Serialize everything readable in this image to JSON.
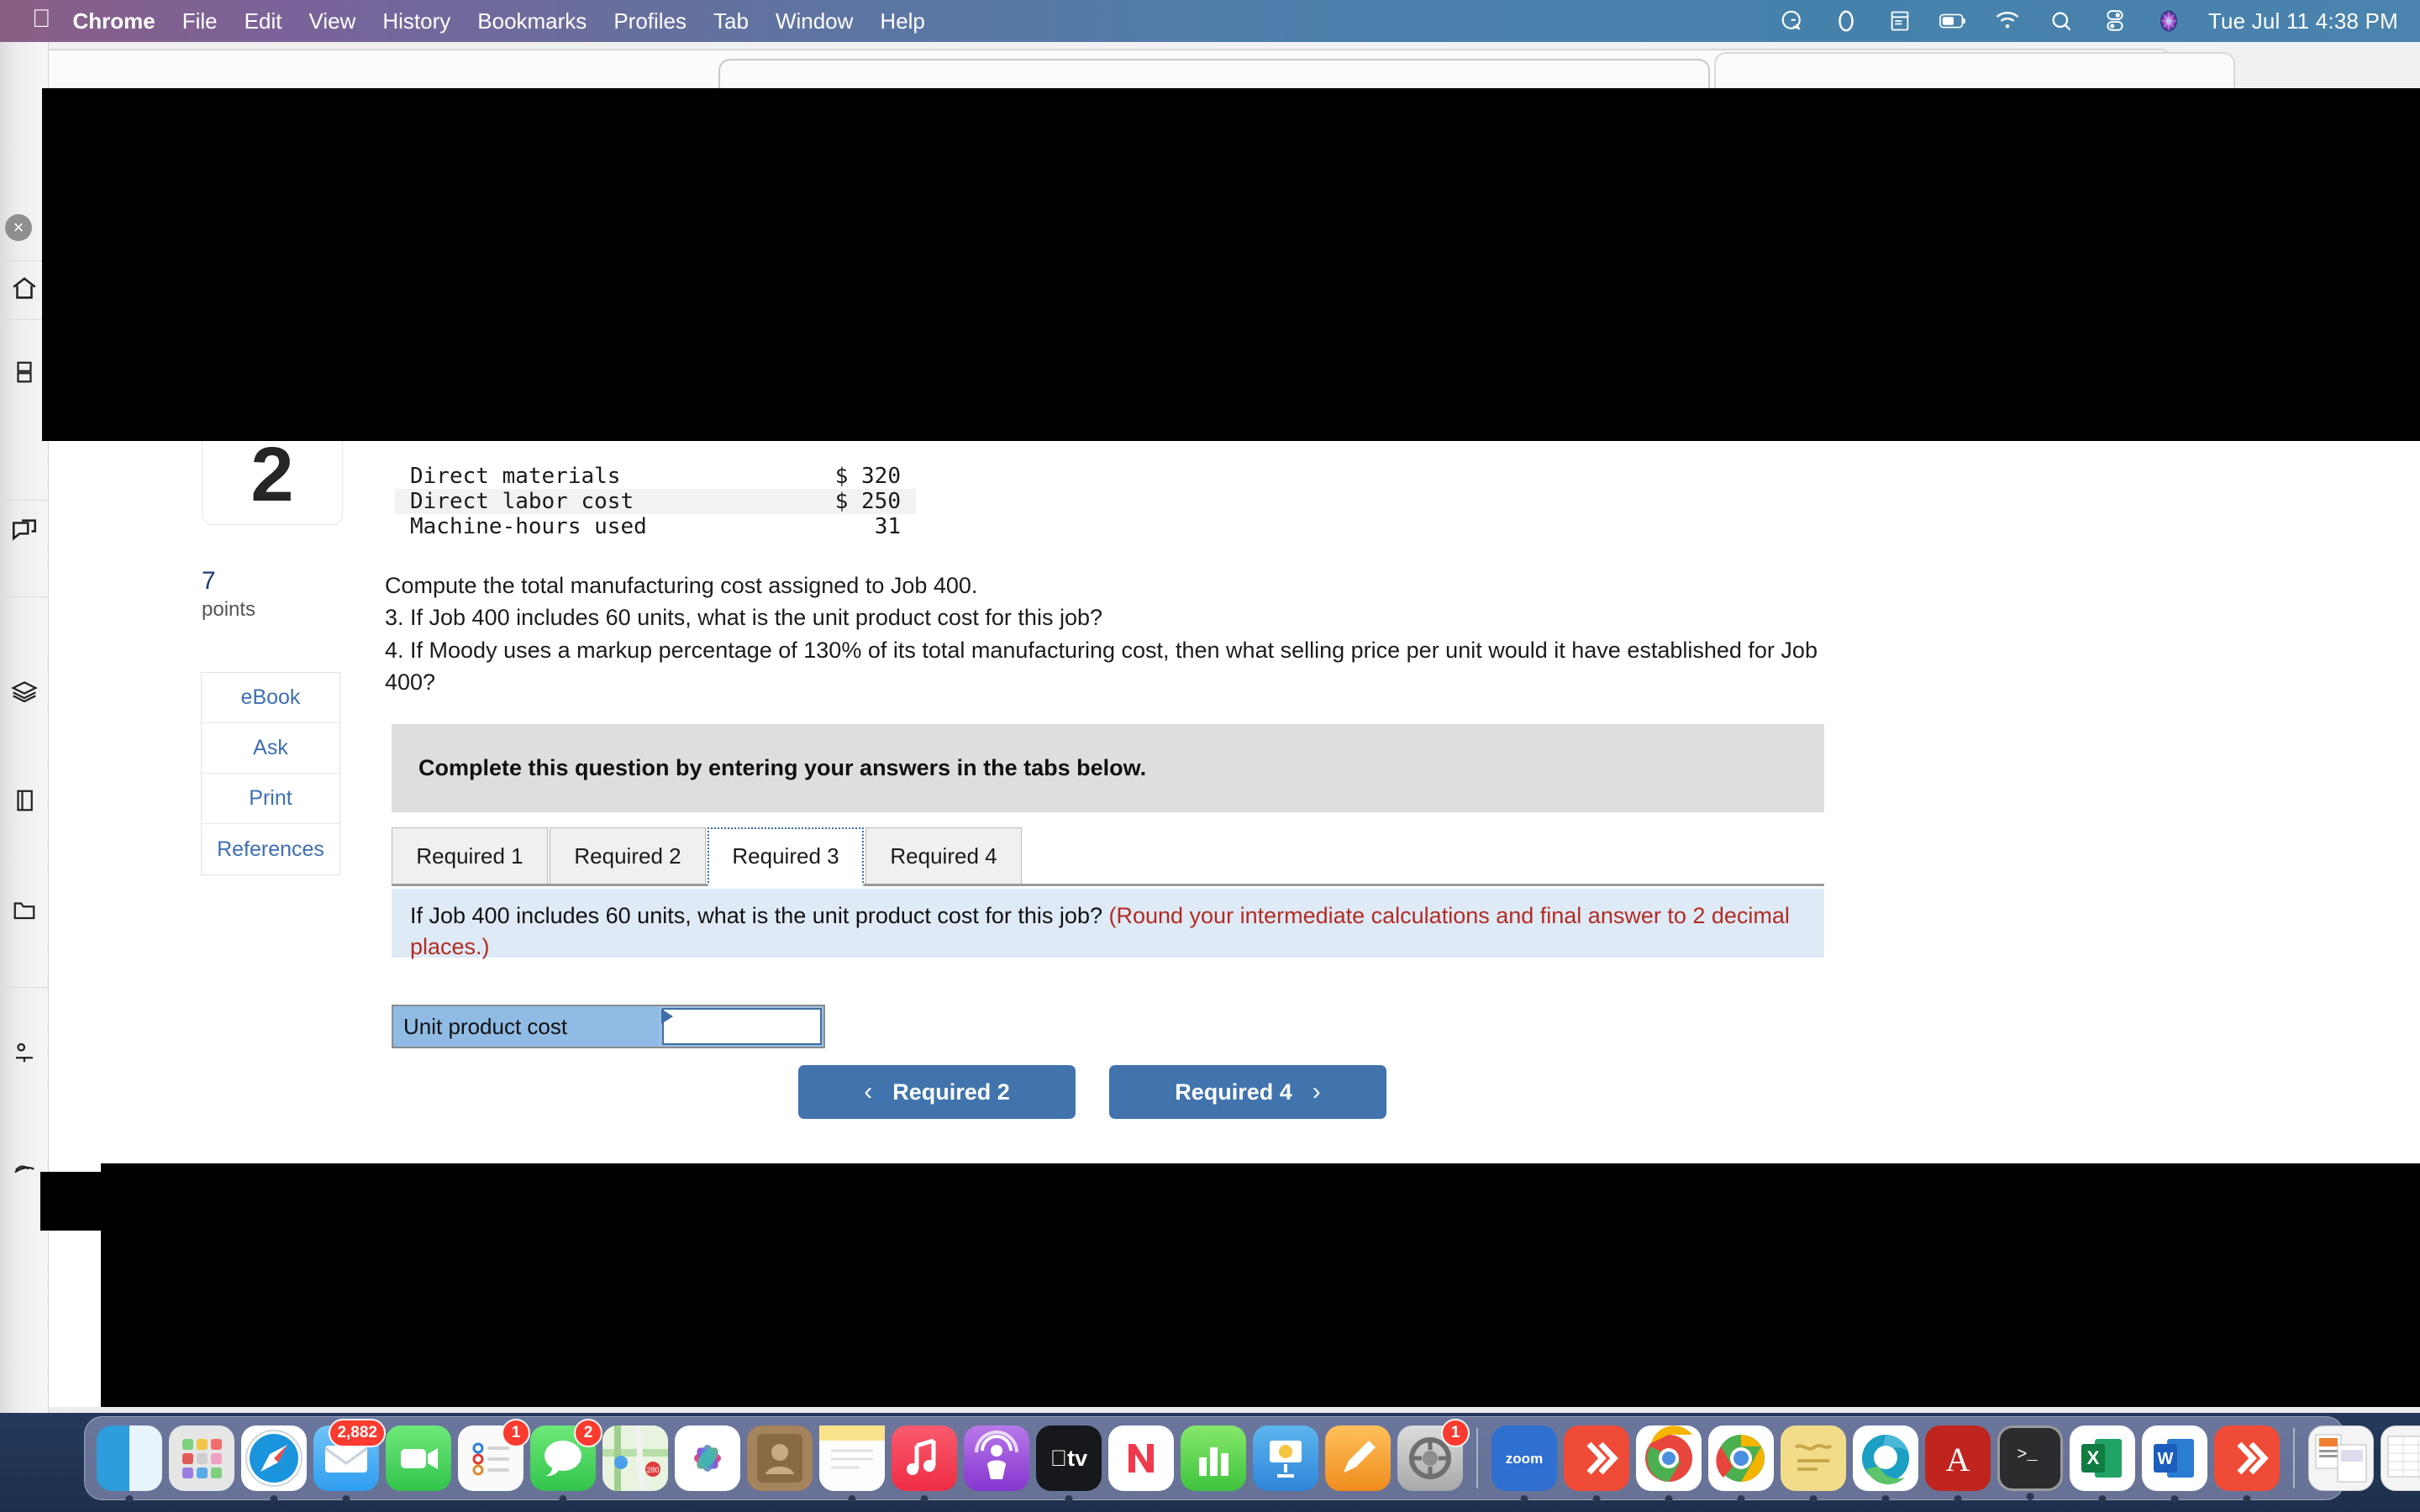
{
  "menubar": {
    "apple": "",
    "items": [
      {
        "label": "Chrome",
        "bold": true
      },
      {
        "label": "File",
        "bold": false
      },
      {
        "label": "Edit",
        "bold": false
      },
      {
        "label": "View",
        "bold": false
      },
      {
        "label": "History",
        "bold": false
      },
      {
        "label": "Bookmarks",
        "bold": false
      },
      {
        "label": "Profiles",
        "bold": false
      },
      {
        "label": "Tab",
        "bold": false
      },
      {
        "label": "Window",
        "bold": false
      },
      {
        "label": "Help",
        "bold": false
      }
    ],
    "status_icons": [
      "grammarly-icon",
      "dropbox-icon",
      "keyboard-shortcut-icon",
      "battery-icon",
      "wifi-icon",
      "spotlight-search-icon",
      "control-center-icon",
      "siri-icon"
    ],
    "clock": "Tue Jul 11  4:38 PM"
  },
  "question": {
    "number": "2",
    "points_value": "7",
    "points_label": "points",
    "side_buttons": [
      {
        "label": "eBook"
      },
      {
        "label": "Ask"
      },
      {
        "label": "Print"
      },
      {
        "label": "References"
      }
    ],
    "data_table": {
      "rows": [
        {
          "label": "Direct materials",
          "value": "$ 320"
        },
        {
          "label": "Direct labor cost",
          "value": "$ 250"
        },
        {
          "label": "Machine-hours used",
          "value": "31"
        }
      ]
    },
    "prompt_lines": [
      "Compute the total manufacturing cost assigned to Job 400.",
      "3. If Job 400 includes 60 units, what is the unit product cost for this job?",
      "4. If Moody uses a markup percentage of 130% of its total manufacturing cost, then what selling price per unit would it have established for Job 400?"
    ],
    "banner_text": "Complete this question by entering your answers in the tabs below.",
    "tabs": [
      {
        "label": "Required 1",
        "active": false
      },
      {
        "label": "Required 2",
        "active": false
      },
      {
        "label": "Required 3",
        "active": true
      },
      {
        "label": "Required 4",
        "active": false
      }
    ],
    "panel": {
      "question": "If Job 400 includes 60 units, what is the unit product cost for this job? ",
      "hint": "(Round your intermediate calculations and final answer to 2 decimal places.)",
      "hint_color": "#b32b22"
    },
    "answer_row": {
      "label": "Unit product cost",
      "value": "",
      "placeholder": ""
    },
    "nav": {
      "prev_label": "Required 2",
      "prev_chevron": "‹",
      "next_label": "Required 4",
      "next_chevron": "›"
    }
  },
  "dock": {
    "items": [
      {
        "name": "finder",
        "color": "#3ba5e8",
        "badge": "",
        "running": true
      },
      {
        "name": "launchpad",
        "color": "#dcdcdc",
        "badge": "",
        "running": false
      },
      {
        "name": "safari",
        "color": "#2d9ff0",
        "badge": "",
        "running": true
      },
      {
        "name": "mail",
        "color": "#42a5f5",
        "badge": "2,882",
        "running": true
      },
      {
        "name": "facetime",
        "color": "#4cd964",
        "badge": "",
        "running": false
      },
      {
        "name": "reminders",
        "color": "#fafafa",
        "badge": "1",
        "running": false
      },
      {
        "name": "messages",
        "color": "#4cd964",
        "badge": "2",
        "running": true
      },
      {
        "name": "maps",
        "color": "#9fd39a",
        "badge": "",
        "running": false
      },
      {
        "name": "photos",
        "color": "#ffffff",
        "badge": "",
        "running": false
      },
      {
        "name": "contacts",
        "color": "#a37b54",
        "badge": "",
        "running": false
      },
      {
        "name": "notes",
        "color": "#fbe38b",
        "badge": "",
        "running": true
      },
      {
        "name": "music",
        "color": "#f4455a",
        "badge": "",
        "running": true
      },
      {
        "name": "podcasts",
        "color": "#9a4fd4",
        "badge": "",
        "running": false
      },
      {
        "name": "apple-tv",
        "color": "#17181c",
        "badge": "",
        "running": true
      },
      {
        "name": "news",
        "color": "#ffffff",
        "badge": "",
        "running": false
      },
      {
        "name": "numbers",
        "color": "#5ed45e",
        "badge": "",
        "running": false
      },
      {
        "name": "keynote",
        "color": "#3a9ce8",
        "badge": "",
        "running": false
      },
      {
        "name": "pages",
        "color": "#f7a72e",
        "badge": "",
        "running": false
      },
      {
        "name": "system-preferences",
        "color": "#b4b4b4",
        "badge": "1",
        "running": false
      },
      {
        "name": "zoom",
        "color": "#2f6fd0",
        "badge": "",
        "running": true
      },
      {
        "name": "anydesk",
        "color": "#ef4b36",
        "badge": "",
        "running": true
      },
      {
        "name": "chrome-alt",
        "color": "#e8453c",
        "badge": "",
        "running": true
      },
      {
        "name": "chrome",
        "color": "#ffffff",
        "badge": "",
        "running": true
      },
      {
        "name": "stickies",
        "color": "#f2dc8a",
        "badge": "",
        "running": true
      },
      {
        "name": "microsoft-edge",
        "color": "#1ba0c4",
        "badge": "",
        "running": true
      },
      {
        "name": "adobe-acrobat",
        "color": "#c0251d",
        "badge": "",
        "running": true
      },
      {
        "name": "terminal",
        "color": "#2c2c2e",
        "badge": "",
        "running": true
      },
      {
        "name": "microsoft-excel",
        "color": "#1d7044",
        "badge": "",
        "running": true
      },
      {
        "name": "microsoft-word",
        "color": "#1b5ebe",
        "badge": "",
        "running": true
      },
      {
        "name": "anydesk-2",
        "color": "#ef4b36",
        "badge": "",
        "running": true
      }
    ],
    "minimized": [
      "minimized-document-window",
      "minimized-spreadsheet-window"
    ],
    "trash": "trash-icon"
  }
}
